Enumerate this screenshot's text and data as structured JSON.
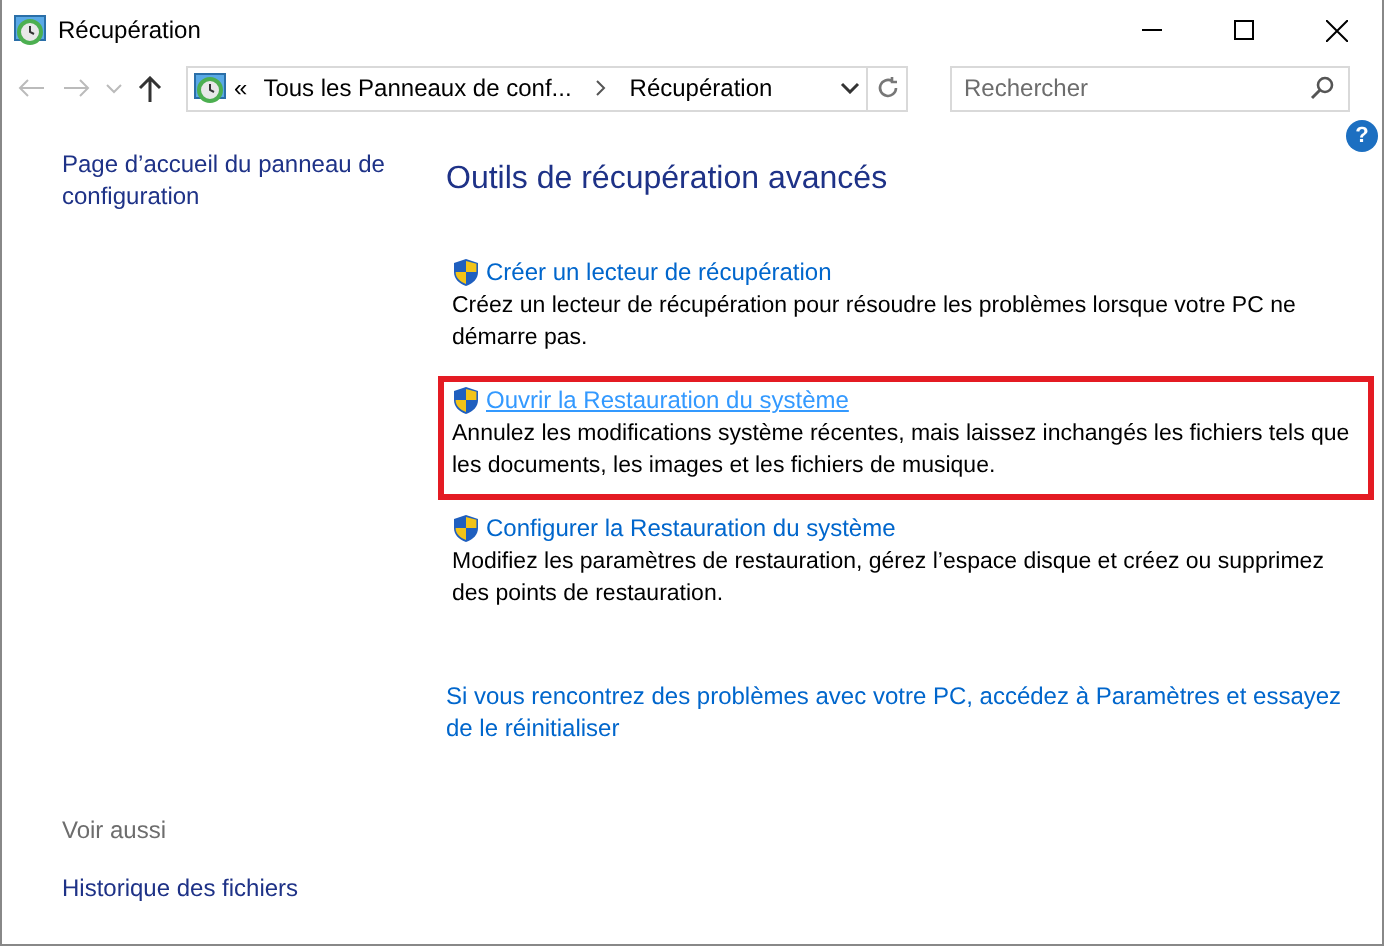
{
  "window": {
    "title": "Récupération"
  },
  "address_bar": {
    "overflow": "«",
    "crumbs": [
      "Tous les Panneaux de conf...",
      "Récupération"
    ]
  },
  "search": {
    "placeholder": "Rechercher"
  },
  "sidebar": {
    "items": [
      "Page d’accueil du panneau de configuration"
    ],
    "see_also_title": "Voir aussi",
    "see_also": [
      "Historique des fichiers"
    ]
  },
  "main": {
    "title": "Outils de récupération avancés",
    "tools": [
      {
        "link": "Créer un lecteur de récupération",
        "description": "Créez un lecteur de récupération pour résoudre les problèmes lorsque votre PC ne démarre pas.",
        "highlighted": false
      },
      {
        "link": "Ouvrir la Restauration du système",
        "description": "Annulez les modifications système récentes, mais laissez inchangés les fichiers tels que les documents, les images et les fichiers de musique.",
        "highlighted": true
      },
      {
        "link": "Configurer la Restauration du système",
        "description": "Modifiez les paramètres de restauration, gérez l’espace disque et créez ou supprimez des points de restauration.",
        "highlighted": false
      }
    ],
    "footer_link": "Si vous rencontrez des problèmes avec votre PC, accédez à Paramètres et essayez de le réinitialiser"
  },
  "help": "?"
}
